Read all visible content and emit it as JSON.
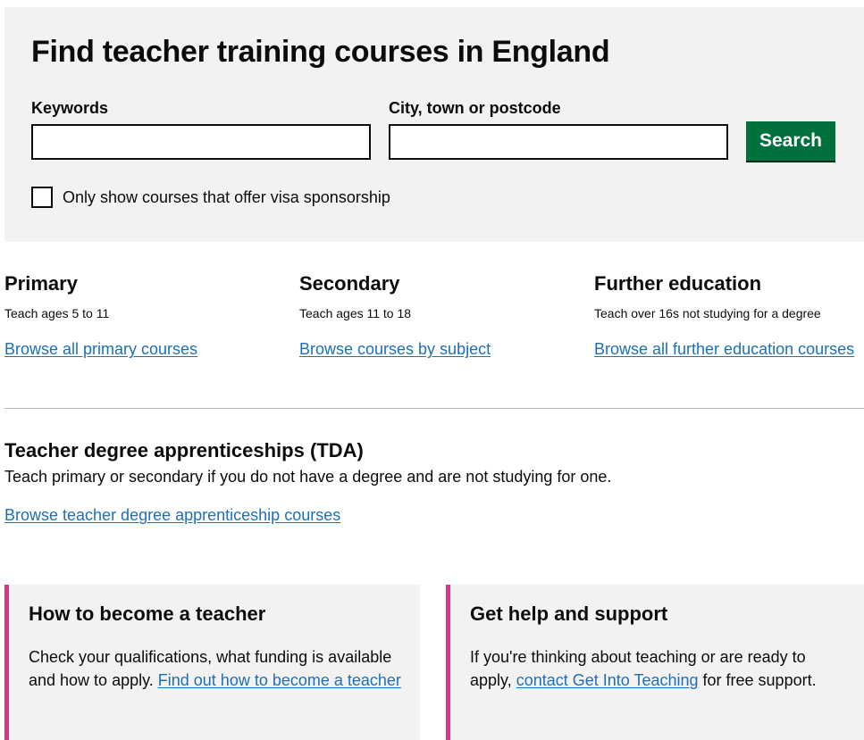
{
  "search": {
    "title": "Find teacher training courses in England",
    "keywords_label": "Keywords",
    "keywords_value": "",
    "location_label": "City, town or postcode",
    "location_value": "",
    "search_button": "Search",
    "visa_checkbox_label": "Only show courses that offer visa sponsorship",
    "visa_checked": false
  },
  "categories": [
    {
      "heading": "Primary",
      "description": "Teach ages 5 to 11",
      "link": "Browse all primary courses"
    },
    {
      "heading": "Secondary",
      "description": "Teach ages 11 to 18",
      "link": "Browse courses by subject"
    },
    {
      "heading": "Further education",
      "description": "Teach over 16s not studying for a degree",
      "link": "Browse all further education courses"
    }
  ],
  "tda": {
    "heading": "Teacher degree apprenticeships (TDA)",
    "description": "Teach primary or secondary if you do not have a degree and are not studying for one.",
    "link": "Browse teacher degree apprenticeship courses"
  },
  "cards": [
    {
      "heading": "How to become a teacher",
      "text_before": "Check your qualifications, what funding is available and how to apply. ",
      "link": "Find out how to become a teacher",
      "text_after": ""
    },
    {
      "heading": "Get help and support",
      "text_before": "If you're thinking about teaching or are ready to apply, ",
      "link": "contact Get Into Teaching",
      "text_after": " for free support."
    }
  ],
  "colors": {
    "panel_bg": "#f3f2f1",
    "button_green": "#00703c",
    "link_blue": "#1d70b8",
    "card_accent": "#d53880"
  }
}
